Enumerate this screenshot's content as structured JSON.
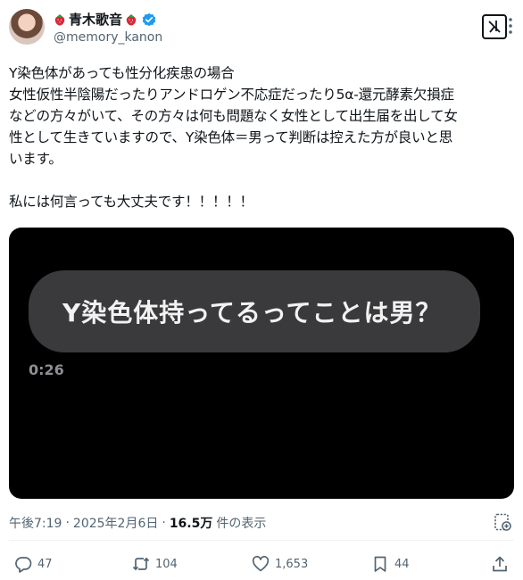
{
  "author": {
    "display_name": "青木歌音",
    "handle": "@memory_kanon",
    "verified": true
  },
  "post": {
    "lines": [
      "Y染色体があっても性分化疾患の場合",
      "女性仮性半陰陽だったりアンドロゲン不応症だったり5α-還元酵素欠損症",
      "などの方々がいて、その方々は何も問題なく女性として出生届を出して女",
      "性として生きていますので、Y染色体＝男って判断は控えた方が良いと思",
      "います。"
    ],
    "last_line": "私には何言っても大丈夫です！！！！！"
  },
  "video": {
    "caption": "Y染色体持ってるってことは男？",
    "timecode": "0:26"
  },
  "meta": {
    "time": "午後7:19",
    "date": "2025年2月6日",
    "sep": "·",
    "views_count": "16.5万",
    "views_label": "件の表示"
  },
  "actions": {
    "replies": "47",
    "reposts": "104",
    "likes": "1,653",
    "bookmarks": "44"
  },
  "colors": {
    "accent": "#1d9bf0",
    "muted": "#536471",
    "text": "#0f1419"
  }
}
